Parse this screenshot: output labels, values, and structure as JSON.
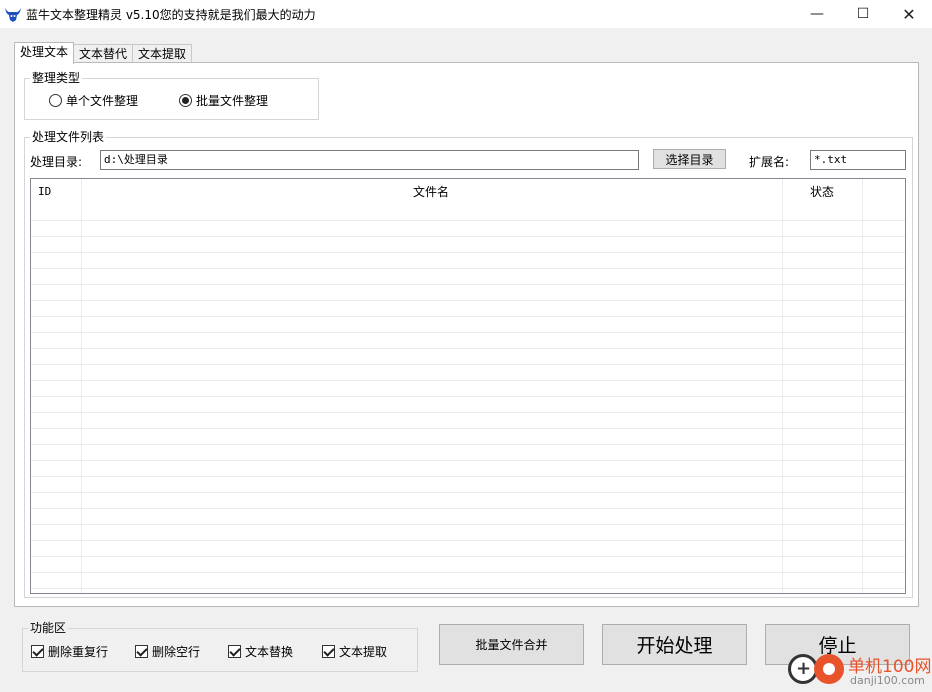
{
  "window": {
    "title": "蓝牛文本整理精灵 v5.10您的支持就是我们最大的动力",
    "minimize_symbol": "—",
    "maximize_symbol": "☐",
    "close_symbol": "✕"
  },
  "tabs": [
    {
      "label": "处理文本",
      "active": true
    },
    {
      "label": "文本替代",
      "active": false
    },
    {
      "label": "文本提取",
      "active": false
    }
  ],
  "organize_type": {
    "legend": "整理类型",
    "options": [
      {
        "label": "单个文件整理",
        "checked": false
      },
      {
        "label": "批量文件整理",
        "checked": true
      }
    ]
  },
  "file_list_group": {
    "legend": "处理文件列表",
    "dir_label": "处理目录:",
    "dir_value": "d:\\处理目录",
    "choose_dir_button": "选择目录",
    "ext_label": "扩展名:",
    "ext_value": "*.txt",
    "columns": [
      "ID",
      "文件名",
      "状态"
    ]
  },
  "function_area": {
    "legend": "功能区",
    "options": [
      {
        "label": "删除重复行",
        "checked": true
      },
      {
        "label": "删除空行",
        "checked": true
      },
      {
        "label": "文本替换",
        "checked": true
      },
      {
        "label": "文本提取",
        "checked": true
      }
    ]
  },
  "actions": {
    "merge_button": "批量文件合并",
    "start_button": "开始处理",
    "stop_button": "停止"
  },
  "watermark": {
    "name": "单机100网",
    "url": "danji100.com"
  },
  "colors": {
    "window_bg": "#f0f0f0",
    "button_bg": "#e1e1e1",
    "watermark_accent": "#e8532b",
    "app_icon": "#1f4fbf"
  }
}
